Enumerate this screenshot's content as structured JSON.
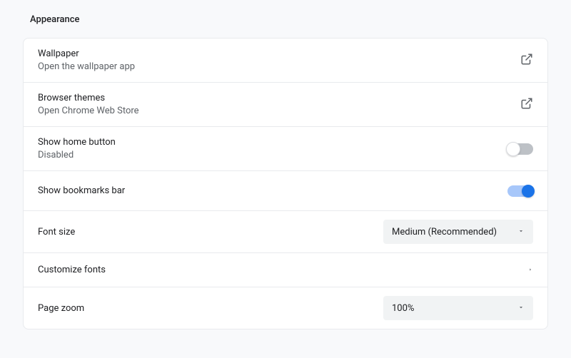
{
  "section": {
    "title": "Appearance"
  },
  "rows": {
    "wallpaper": {
      "title": "Wallpaper",
      "sub": "Open the wallpaper app"
    },
    "themes": {
      "title": "Browser themes",
      "sub": "Open Chrome Web Store"
    },
    "homeButton": {
      "title": "Show home button",
      "sub": "Disabled",
      "enabled": false
    },
    "bookmarksBar": {
      "title": "Show bookmarks bar",
      "enabled": true
    },
    "fontSize": {
      "title": "Font size",
      "value": "Medium (Recommended)"
    },
    "customizeFonts": {
      "title": "Customize fonts"
    },
    "pageZoom": {
      "title": "Page zoom",
      "value": "100%"
    }
  }
}
